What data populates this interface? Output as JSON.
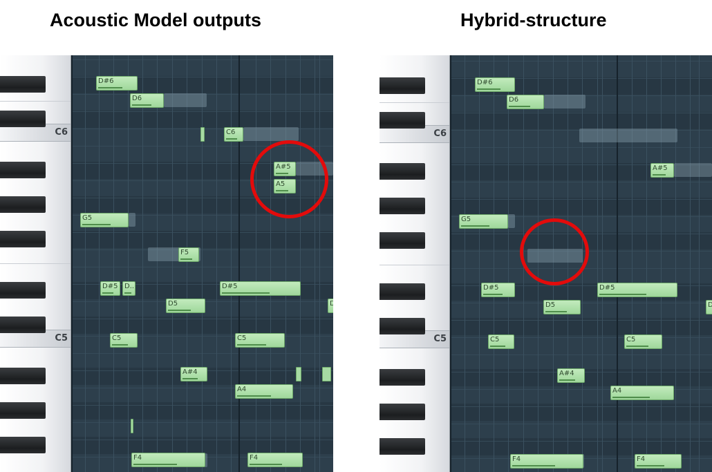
{
  "titles": {
    "left": "Acoustic Model outputs",
    "right": "Hybrid-structure"
  },
  "keyboard_labels": {
    "c6": "C6",
    "c5": "C5"
  },
  "colors": {
    "grid": "#2d3f4c",
    "note": "#9fd79b",
    "ghost": "#92aab8",
    "highlight_circle": "#e30b0b"
  },
  "left_roll": {
    "notes": [
      {
        "label": "D#6"
      },
      {
        "label": "D6"
      },
      {
        "label": "C6"
      },
      {
        "label": "A#5"
      },
      {
        "label": "A5"
      },
      {
        "label": "G5"
      },
      {
        "label": "F5"
      },
      {
        "label": "D#5"
      },
      {
        "label": "D..."
      },
      {
        "label": "D#5"
      },
      {
        "label": "D5"
      },
      {
        "label": "D"
      },
      {
        "label": "C5"
      },
      {
        "label": "C5"
      },
      {
        "label": "A#4"
      },
      {
        "label": "A4"
      },
      {
        "label": "F4"
      },
      {
        "label": "F4"
      }
    ]
  },
  "right_roll": {
    "notes": [
      {
        "label": "D#6"
      },
      {
        "label": "D6"
      },
      {
        "label": "A#5"
      },
      {
        "label": "G5"
      },
      {
        "label": "D#5"
      },
      {
        "label": "D#5"
      },
      {
        "label": "D5"
      },
      {
        "label": "D"
      },
      {
        "label": "C5"
      },
      {
        "label": "C5"
      },
      {
        "label": "A#4"
      },
      {
        "label": "A4"
      },
      {
        "label": "F4"
      },
      {
        "label": "F4"
      }
    ]
  }
}
